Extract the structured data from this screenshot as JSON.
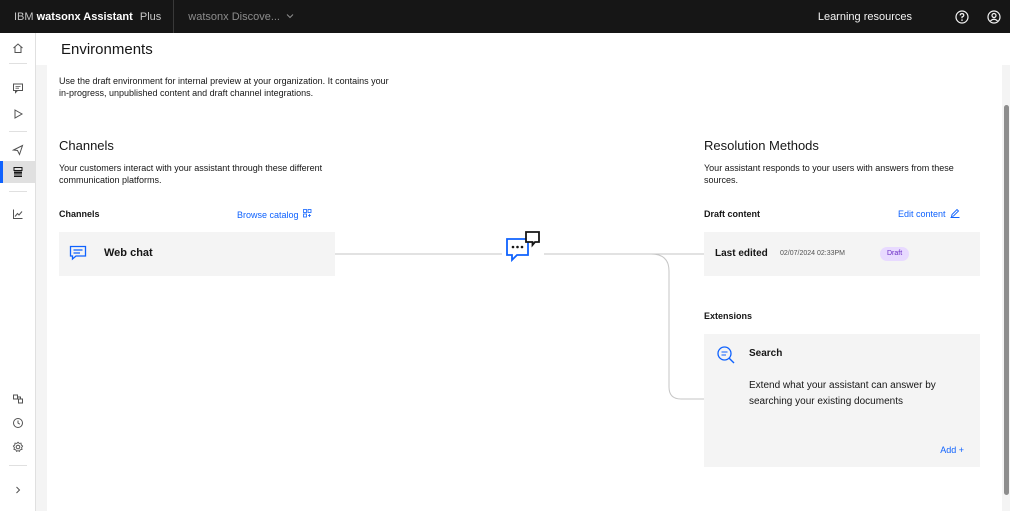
{
  "topbar": {
    "brand_ibm": "IBM",
    "brand_product": "watsonx Assistant",
    "brand_plan": "Plus",
    "instance": "watsonx Discove...",
    "learning_resources": "Learning resources"
  },
  "page": {
    "title": "Environments",
    "intro": "Use the draft environment for internal preview at your organization. It contains your in-progress, unpublished content and draft channel integrations."
  },
  "channels": {
    "title": "Channels",
    "description": "Your customers interact with your assistant through these different communication platforms.",
    "list_label": "Channels",
    "browse_link": "Browse catalog",
    "items": [
      {
        "label": "Web chat"
      }
    ]
  },
  "resolution": {
    "title": "Resolution Methods",
    "description": "Your assistant responds to your users with answers from these sources.",
    "draft_label": "Draft content",
    "edit_link": "Edit content",
    "last_edited_label": "Last edited",
    "last_edited_date": "02/07/2024 02:33PM",
    "status_badge": "Draft",
    "extensions_label": "Extensions",
    "search_title": "Search",
    "search_desc": "Extend what your assistant can answer by searching your existing documents",
    "add_link": "Add +"
  },
  "colors": {
    "accent": "#0f62fe",
    "topbar": "#161616",
    "badge_bg": "#e8daff",
    "badge_text": "#6929c4"
  }
}
